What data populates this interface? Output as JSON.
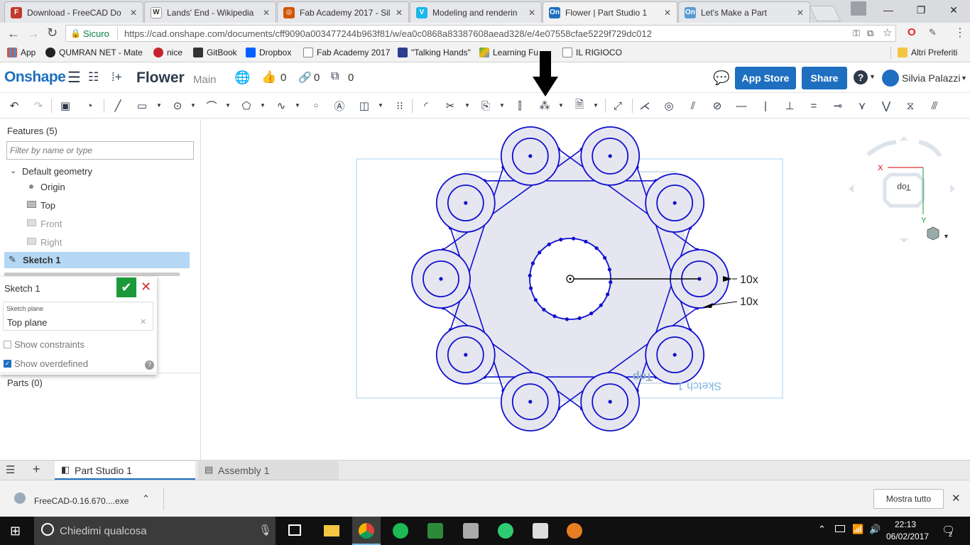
{
  "browser": {
    "tabs": [
      {
        "title": "Download - FreeCAD Do",
        "icon": "freecad-icon",
        "color": "#c0392b"
      },
      {
        "title": "Lands' End - Wikipedia",
        "icon": "wikipedia-icon",
        "color": "#666666"
      },
      {
        "title": "Fab Academy 2017 - Sil",
        "icon": "fab-icon",
        "color": "#d35400"
      },
      {
        "title": "Modeling and renderin",
        "icon": "vimeo-icon",
        "color": "#1ab7ea"
      },
      {
        "title": "Flower | Part Studio 1",
        "icon": "onshape-icon",
        "color": "#1e6fbf"
      },
      {
        "title": "Let's Make a Part",
        "icon": "onshape-icon",
        "color": "#5b9bd5"
      }
    ],
    "secure_label": "Sicuro",
    "url": "https://cad.onshape.com/documents/cff9090a003477244b963f81/w/ea0c0868a83387608aead328/e/4e07558cfae5229f729dc012",
    "bookmarks": [
      "App",
      "QUMRAN NET - Mate",
      "nice",
      "GitBook",
      "Dropbox",
      "Fab Academy 2017",
      "\"Talking Hands\"",
      "Learning Fu",
      "IL RIGIOCO"
    ],
    "other_bookmarks": "Altri Preferiti"
  },
  "header": {
    "logo": "Onshape",
    "doc_title": "Flower",
    "branch": "Main",
    "likes": "0",
    "links": "0",
    "copies": "0",
    "app_store": "App Store",
    "share": "Share",
    "user": "Silvia Palazzi"
  },
  "features": {
    "title": "Features (5)",
    "filter_placeholder": "Filter by name or type",
    "default_geometry": "Default geometry",
    "items": [
      "Origin",
      "Top",
      "Front",
      "Right"
    ],
    "sketch": "Sketch 1"
  },
  "sketch_dialog": {
    "title": "Sketch 1",
    "plane_label": "Sketch plane",
    "plane_value": "Top plane",
    "show_constraints": "Show constraints",
    "show_overdefined": "Show overdefined"
  },
  "parts": "Parts (0)",
  "canvas": {
    "annotation1": "10x",
    "annotation2": "10x",
    "plane_label": "Top",
    "sketch_label": "Sketch 1",
    "viewcube_label": "Top",
    "axis_x": "X",
    "axis_y": "Y"
  },
  "bottom_tabs": [
    "Part Studio 1",
    "Assembly 1"
  ],
  "download": {
    "file": "FreeCAD-0.16.670....exe",
    "show_all": "Mostra tutto"
  },
  "taskbar": {
    "search": "Chiedimi qualcosa",
    "time": "22:13",
    "date": "06/02/2017",
    "notifications": "2"
  },
  "colors": {
    "accent": "#1e6fbf",
    "sketch": "#1010d0",
    "selection": "#b3d7f5"
  }
}
